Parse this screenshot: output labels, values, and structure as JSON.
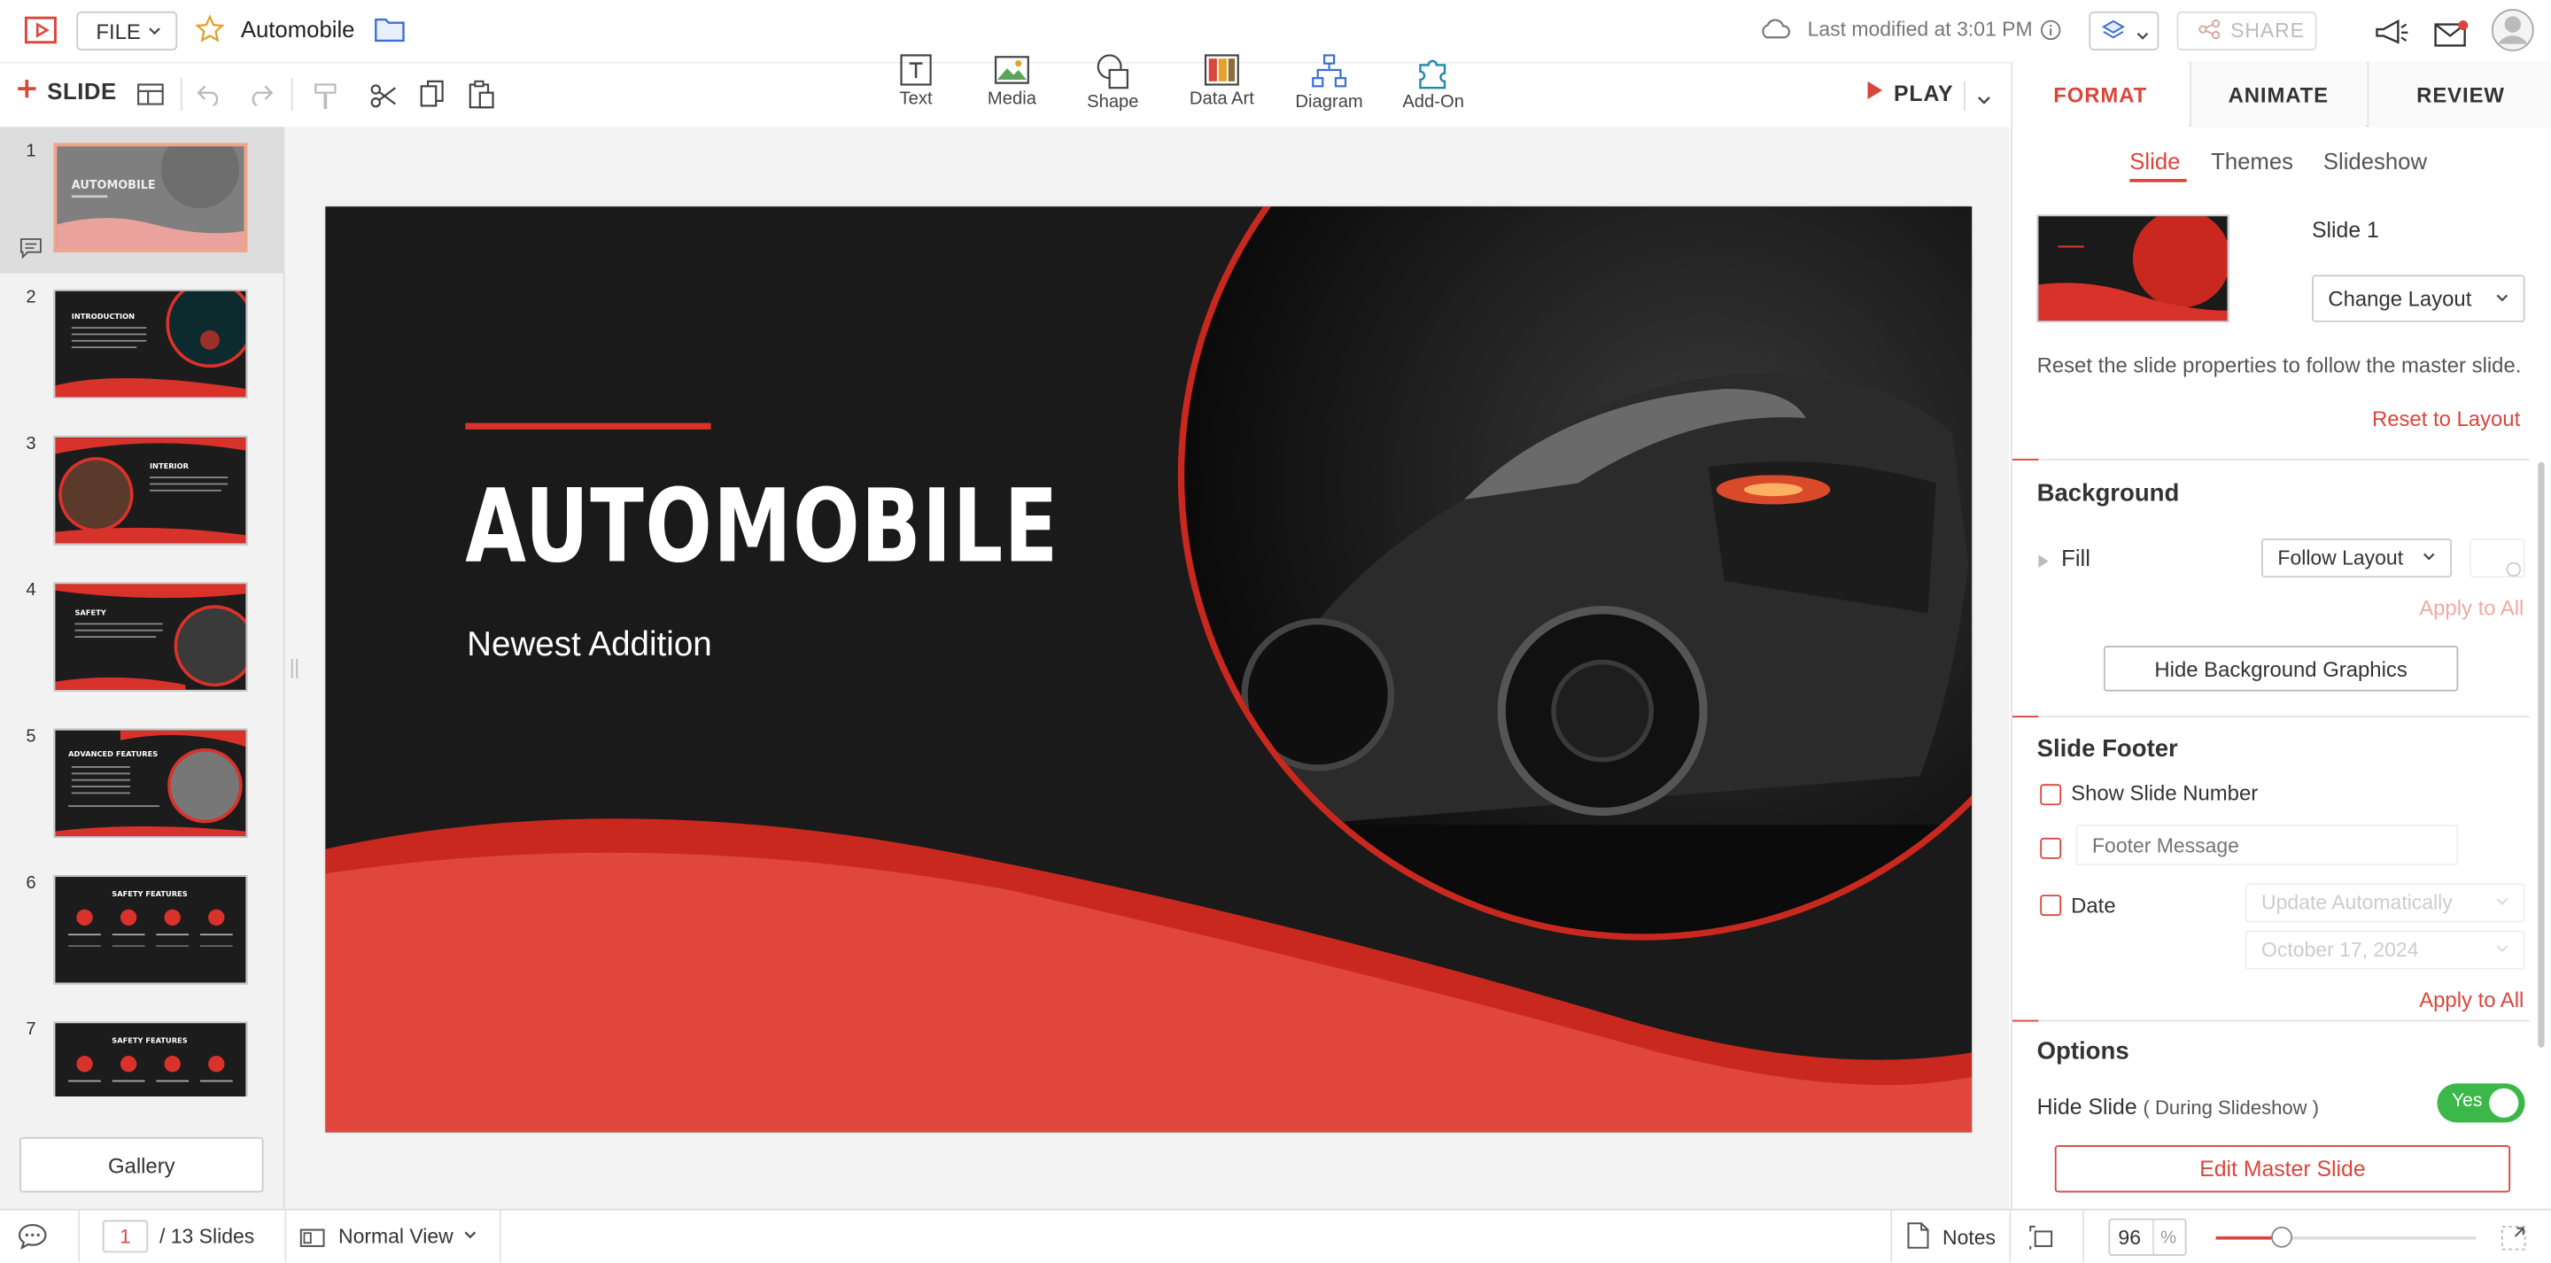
{
  "header": {
    "file_label": "FILE",
    "doc_title": "Automobile",
    "last_modified": "Last modified at 3:01 PM",
    "share_label": "SHARE"
  },
  "toolbar": {
    "slide_label": "SLIDE",
    "tools": [
      {
        "label": "Text",
        "icon": "text-box-icon"
      },
      {
        "label": "Media",
        "icon": "image-icon"
      },
      {
        "label": "Shape",
        "icon": "shape-icon"
      },
      {
        "label": "Data Art",
        "icon": "data-art-icon"
      },
      {
        "label": "Diagram",
        "icon": "diagram-icon"
      },
      {
        "label": "Add-On",
        "icon": "puzzle-icon"
      }
    ],
    "play_label": "PLAY"
  },
  "right_tabs": [
    "FORMAT",
    "ANIMATE",
    "REVIEW"
  ],
  "slides": [
    {
      "num": "1",
      "title": "AUTOMOBILE"
    },
    {
      "num": "2",
      "title": "INTRODUCTION"
    },
    {
      "num": "3",
      "title": "INTERIOR"
    },
    {
      "num": "4",
      "title": "SAFETY"
    },
    {
      "num": "5",
      "title": "ADVANCED FEATURES"
    },
    {
      "num": "6",
      "title": "SAFETY FEATURES"
    },
    {
      "num": "7",
      "title": "SAFETY FEATURES"
    }
  ],
  "gallery_label": "Gallery",
  "slide": {
    "title": "AUTOMOBILE",
    "subtitle": "Newest Addition",
    "colors": {
      "bg": "#1a1a1a",
      "accent": "#d9322a",
      "wave": "#e0463b"
    }
  },
  "format_panel": {
    "sub_tabs": [
      "Slide",
      "Themes",
      "Slideshow"
    ],
    "slide_name": "Slide 1",
    "change_layout": "Change Layout",
    "reset_text": "Reset the slide properties to follow the master slide.",
    "reset_link": "Reset to Layout",
    "background_title": "Background",
    "fill_label": "Fill",
    "fill_value": "Follow Layout",
    "apply_all": "Apply to All",
    "hide_bg_btn": "Hide Background Graphics",
    "footer_title": "Slide Footer",
    "show_slide_number": "Show Slide Number",
    "footer_placeholder": "Footer Message",
    "date_label": "Date",
    "date_mode": "Update Automatically",
    "date_value": "October 17, 2024",
    "apply_all_2": "Apply to All",
    "options_title": "Options",
    "hide_slide_label": "Hide Slide",
    "hide_slide_note": "( During Slideshow )",
    "hide_slide_toggle": "Yes",
    "edit_master": "Edit Master Slide"
  },
  "status": {
    "current_slide": "1",
    "total_slides": "/ 13 Slides",
    "view_mode": "Normal View",
    "notes_label": "Notes",
    "zoom": "96",
    "zoom_unit": "%",
    "zoom_level": 0.25
  }
}
